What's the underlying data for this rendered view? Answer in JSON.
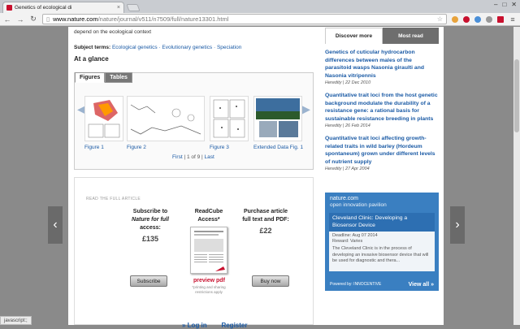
{
  "browser": {
    "tab_title": "Genetics of ecological di",
    "tab_close": "×",
    "url_host": "www.nature.com",
    "url_path": "/nature/journal/v511/n7509/full/nature13301.html",
    "window_controls": [
      "‒",
      "□",
      "✕"
    ],
    "status_text": "javascript:;"
  },
  "article": {
    "intro_text": "depend on the ecological context",
    "subject_label": "Subject terms:",
    "subject_terms": "Ecological genetics · Evolutionary genetics · Speciation",
    "glance_title": "At a glance",
    "fig_tab_figures": "Figures",
    "fig_tab_tables": "Tables",
    "figures": [
      "Figure 1",
      "Figure 2",
      "Figure 3",
      "Extended Data Fig. 1"
    ],
    "pager_first": "First",
    "pager_text": "| 1 of 9 |",
    "pager_last": "Last"
  },
  "access": {
    "heading": "READ THE FULL ARTICLE",
    "subscribe_line1": "Subscribe to",
    "subscribe_line2": "Nature for full",
    "subscribe_line3": "access:",
    "subscribe_price": "£135",
    "readcube_line1": "ReadCube",
    "readcube_line2": "Access*",
    "purchase_line1": "Purchase article",
    "purchase_line2": "full text and PDF:",
    "purchase_price": "£22",
    "preview_link": "preview pdf",
    "preview_note": "*printing and sharing restrictions apply",
    "subscribe_button": "Subscribe",
    "buy_button": "Buy now",
    "login_link": "Log in",
    "register_link": "Register"
  },
  "sidebar": {
    "tab_discover": "Discover more",
    "tab_most_read": "Most read",
    "related": [
      {
        "title": "Genetics of cuticular hydrocarbon differences between males of the parasitoid wasps Nasonia giraulti and Nasonia vitripennis",
        "meta": "Heredity | 22 Dec 2010"
      },
      {
        "title": "Quantitative trait loci from the host genetic background modulate the durability of a resistance gene: a rational basis for sustainable resistance breeding in plants",
        "meta": "Heredity | 26 Feb 2014"
      },
      {
        "title": "Quantitative trait loci affecting growth-related traits in wild barley (Hordeum spontaneum) grown under different levels of nutrient supply",
        "meta": "Heredity | 27 Apr 2004"
      }
    ],
    "ad": {
      "logo_line1": "nature.com",
      "logo_line2": "open innovation pavilion",
      "card_title": "Cleveland Clinic: Developing a Biosensor Device",
      "deadline": "Deadline: Aug 07 2014",
      "reward": "Reward: Varies",
      "description": "The Cleveland Clinic is in the process of developing an invasive biosensor device that will be used for diagnostic and thera...",
      "powered": "Powered by: INNOCENTIVE",
      "view_all": "View all »"
    }
  },
  "nav": {
    "prev_arrow": "‹",
    "next_arrow": "›"
  },
  "colors": {
    "link": "#1a5aa5",
    "accent_red": "#c8102e",
    "ad_blue": "#3a7fc1"
  }
}
